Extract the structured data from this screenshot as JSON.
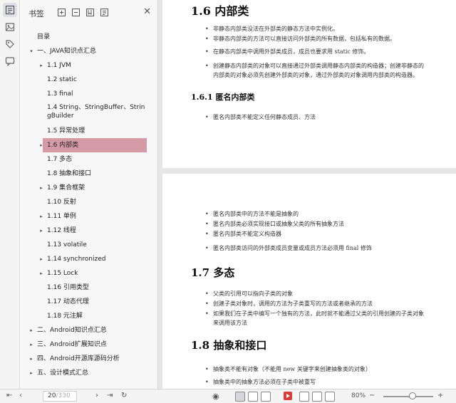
{
  "panel": {
    "title": "书签",
    "close": "✕"
  },
  "tree": [
    {
      "label": "目录",
      "arrow": ""
    },
    {
      "label": "一、JAVA知识点汇总",
      "arrow": "▾"
    },
    {
      "label": "1.1 JVM",
      "arrow": "▸"
    },
    {
      "label": "1.2 static",
      "arrow": ""
    },
    {
      "label": "1.3 final",
      "arrow": ""
    },
    {
      "label": "1.4 String、StringBuffer、StringBuilder",
      "arrow": ""
    },
    {
      "label": "1.5 异常处理",
      "arrow": ""
    },
    {
      "label": "1.6 内部类",
      "arrow": "▸"
    },
    {
      "label": "1.7 多态",
      "arrow": ""
    },
    {
      "label": "1.8 抽象和接口",
      "arrow": ""
    },
    {
      "label": "1.9 集合框架",
      "arrow": "▸"
    },
    {
      "label": "1.10 反射",
      "arrow": ""
    },
    {
      "label": "1.11 单例",
      "arrow": "▸"
    },
    {
      "label": "1.12 线程",
      "arrow": "▸"
    },
    {
      "label": "1.13 volatile",
      "arrow": ""
    },
    {
      "label": "1.14 synchronized",
      "arrow": "▸"
    },
    {
      "label": "1.15 Lock",
      "arrow": "▸"
    },
    {
      "label": "1.16 引用类型",
      "arrow": ""
    },
    {
      "label": "1.17 动态代理",
      "arrow": ""
    },
    {
      "label": "1.18 元注解",
      "arrow": ""
    },
    {
      "label": "二、Android知识点汇总",
      "arrow": "▸"
    },
    {
      "label": "三、Android扩展知识点",
      "arrow": "▸"
    },
    {
      "label": "四、Android开源库源码分析",
      "arrow": "▸"
    },
    {
      "label": "五、设计模式汇总",
      "arrow": "▸"
    }
  ],
  "page1": {
    "heading": "1.6 内部类",
    "bullets": [
      "非静态内部类没法在外部类的静态方法中实例化。",
      "非静态内部类的方法可以直接访问外部类的所有数据，包括私有的数据。",
      "在静态内部类中调用外部类成员，成员也要求用 static 修饰。",
      "创建静态内部类的对象可以直接通过外部类调用静态内部类的构造器；创建非静态的",
      "内部类的对象必须先创建外部类的对象，通过外部类的对象调用内部类的构造器。"
    ],
    "subheading": "1.6.1 匿名内部类",
    "sub_bullets": [
      "匿名内部类不能定义任何静态成员、方法"
    ]
  },
  "page2": {
    "bullets": [
      "匿名内部类中的方法不能是抽象的",
      "匿名内部类必须实现接口或抽象父类的所有抽象方法",
      "匿名内部类不能定义构造器",
      "匿名内部类访问的外部类成员变量或成员方法必须用 final 修饰"
    ],
    "heading17": "1.7 多态",
    "bullets17": [
      "父类的引用可以指向子类的对象",
      "创建子类对象时，调用的方法为子类重写的方法或者继承的方法",
      "如果我们在子类中编写一个独有的方法，此时就不能通过父类的引用创建的子类对象",
      "来调用该方法"
    ],
    "heading18": "1.8 抽象和接口",
    "bullets18": [
      "抽象类不能有对象（不能用 new 关键字来创建抽象类的对象）",
      "抽象类中的抽象方法必须在子类中被重写"
    ]
  },
  "status": {
    "page_current": "20",
    "page_total": "/330",
    "zoom": "80%",
    "zoom_minus": "−",
    "zoom_plus": "+"
  }
}
